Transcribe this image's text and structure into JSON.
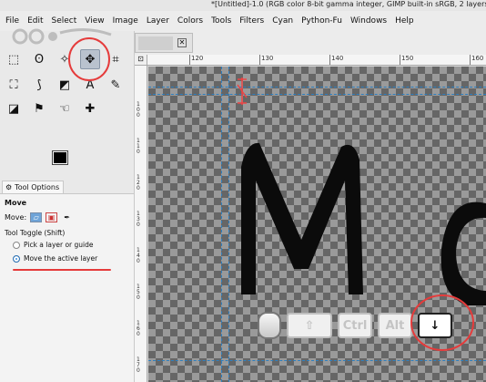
{
  "window": {
    "title": "*[Untitled]-1.0 (RGB color 8-bit gamma integer, GIMP built-in sRGB, 2 layers"
  },
  "menu": [
    "File",
    "Edit",
    "Select",
    "View",
    "Image",
    "Layer",
    "Colors",
    "Tools",
    "Filters",
    "Cyan",
    "Python-Fu",
    "Windows",
    "Help"
  ],
  "toolbox": {
    "tools": [
      {
        "name": "rect-select",
        "glyph": "⬚"
      },
      {
        "name": "free-select",
        "glyph": "ʘ"
      },
      {
        "name": "fuzzy-select",
        "glyph": "✧"
      },
      {
        "name": "move",
        "glyph": "✥"
      },
      {
        "name": "crop",
        "glyph": "⌗"
      },
      {
        "name": "unified-transform",
        "glyph": "⛶"
      },
      {
        "name": "warp",
        "glyph": "⟆"
      },
      {
        "name": "bucket-fill",
        "glyph": "◩"
      },
      {
        "name": "text",
        "glyph": "A"
      },
      {
        "name": "paintbrush",
        "glyph": "✎"
      },
      {
        "name": "eraser",
        "glyph": "◪"
      },
      {
        "name": "clone",
        "glyph": "⚑"
      },
      {
        "name": "smudge",
        "glyph": "☜"
      },
      {
        "name": "heal",
        "glyph": "✚"
      }
    ],
    "colors": {
      "fg": "#000000",
      "bg": "#ffffff"
    }
  },
  "tool_options": {
    "tab_label": "Tool Options",
    "heading": "Move",
    "move_label": "Move:",
    "toggle_label": "Tool Toggle  (Shift)",
    "options": [
      {
        "label": "Pick a layer or guide",
        "selected": false
      },
      {
        "label": "Move the active layer",
        "selected": true
      }
    ]
  },
  "rulers": {
    "h_ticks": [
      "120",
      "130",
      "140",
      "150",
      "160"
    ],
    "v_ticks": [
      "1\n0\n0",
      "1\n1\n0",
      "1\n2\n0",
      "1\n3\n0",
      "1\n4\n0",
      "1\n5\n0",
      "1\n6\n0",
      "1\n7\n0"
    ]
  },
  "canvas": {
    "text": "Mc"
  },
  "keys": [
    {
      "name": "mouse",
      "label": ""
    },
    {
      "name": "shift",
      "label": "⇧",
      "pressed": false
    },
    {
      "name": "ctrl",
      "label": "Ctrl",
      "pressed": false
    },
    {
      "name": "alt",
      "label": "Alt",
      "pressed": false
    },
    {
      "name": "down-arrow",
      "label": "↓",
      "pressed": true
    }
  ],
  "annotation_color": "#e53b3b"
}
